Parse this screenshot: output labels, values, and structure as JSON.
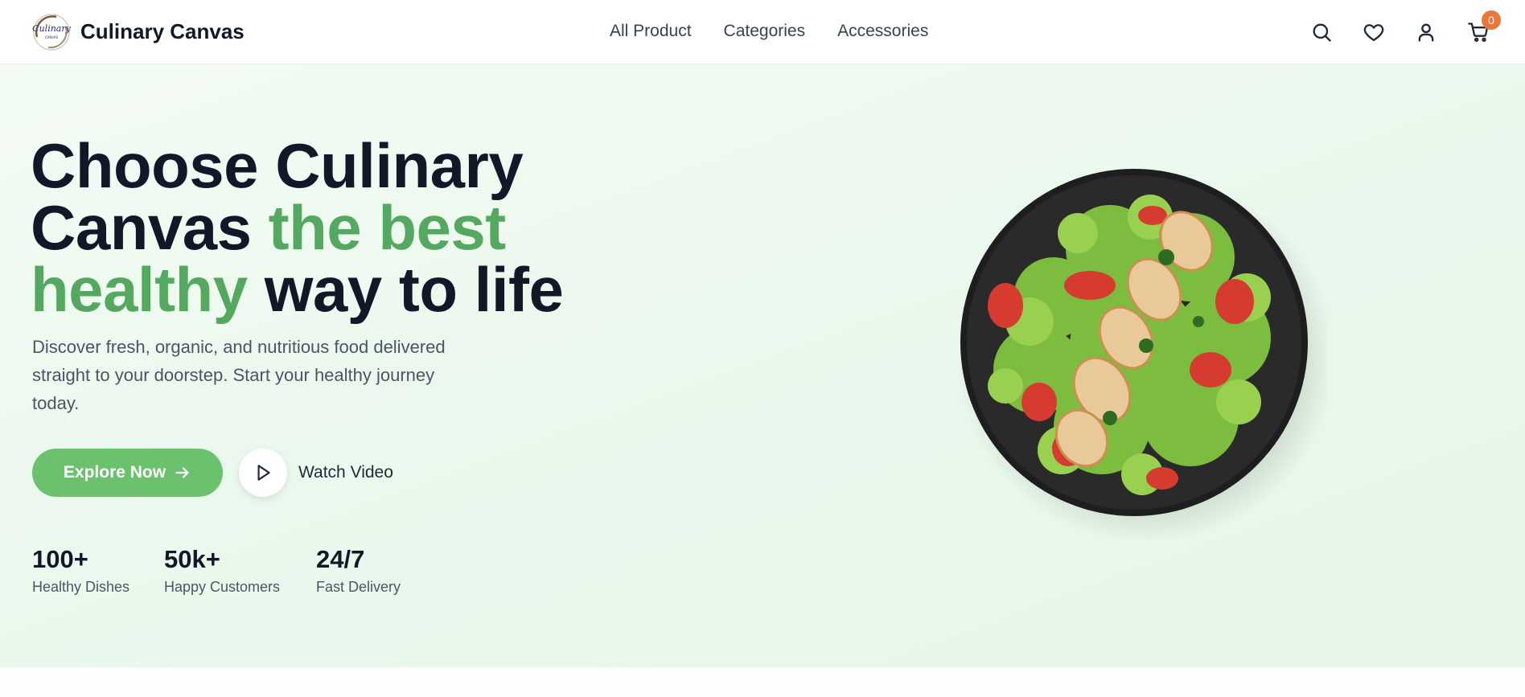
{
  "brand": {
    "name": "Culinary Canvas",
    "logo_text": "Culinary",
    "logo_subtext": "CANVAS"
  },
  "nav": {
    "links": [
      "All Product",
      "Categories",
      "Accessories"
    ]
  },
  "header_icons": [
    "search-icon",
    "heart-icon",
    "user-icon",
    "cart-icon"
  ],
  "cart": {
    "count": "0"
  },
  "hero": {
    "title_line1": "Choose Culinary",
    "title_line2_a": "Canvas ",
    "title_line2_b": "the best",
    "title_line3_a": "healthy",
    "title_line3_b": " way to life",
    "description": "Discover fresh, organic, and nutritious food delivered straight to your doorstep. Start your healthy journey today.",
    "primary_button": "Explore Now",
    "secondary_button": "Watch Video"
  },
  "stats": [
    {
      "value": "100+",
      "label": "Healthy Dishes"
    },
    {
      "value": "50k+",
      "label": "Happy Customers"
    },
    {
      "value": "24/7",
      "label": "Fast Delivery"
    }
  ],
  "colors": {
    "accent_green": "#55a85f",
    "button_green": "#6cc16f",
    "badge_orange": "#e9773a",
    "text_dark": "#111827",
    "hero_bg": "#e8f7eb"
  }
}
